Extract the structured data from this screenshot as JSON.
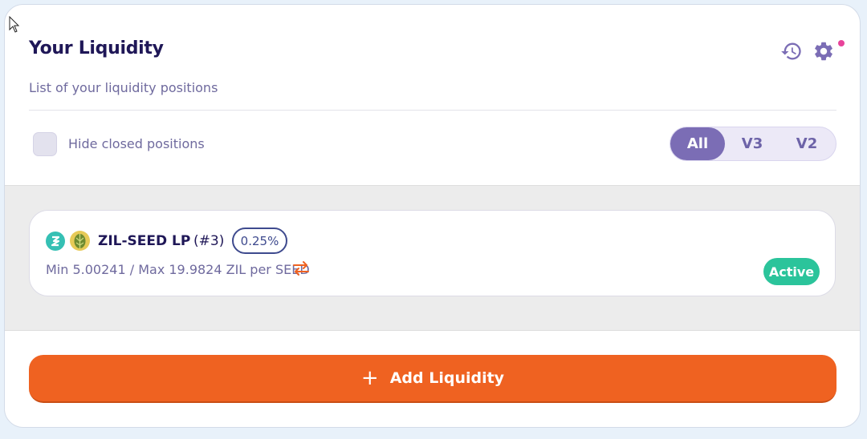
{
  "header": {
    "title": "Your Liquidity",
    "subtitle": "List of your liquidity positions"
  },
  "filters": {
    "hide_closed_label": "Hide closed positions",
    "hide_closed_checked": false,
    "versions": [
      "All",
      "V3",
      "V2"
    ],
    "selected_version": "All"
  },
  "positions": [
    {
      "pair": "ZIL-SEED LP",
      "id": "(#3)",
      "fee": "0.25%",
      "range": "Min 5.00241 / Max 19.9824 ZIL per SEED",
      "status": "Active",
      "token_icons": [
        "zil-icon",
        "seed-icon"
      ]
    }
  ],
  "actions": {
    "add_liquidity_label": "Add Liquidity",
    "add_icon": "+"
  },
  "colors": {
    "primary_text": "#1f1757",
    "secondary_text": "#6f6a9e",
    "accent_purple": "#7b6db5",
    "accent_orange": "#ef6221",
    "active_green": "#2bc49b",
    "notification": "#e8439a"
  }
}
